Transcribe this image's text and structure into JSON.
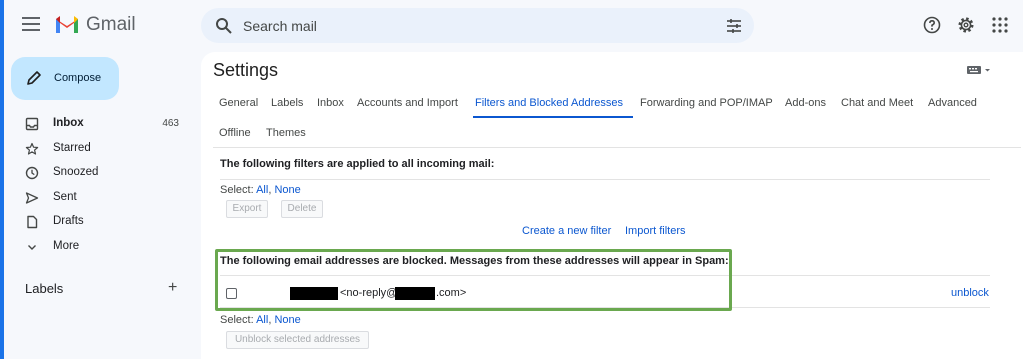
{
  "app": {
    "name": "Gmail"
  },
  "search": {
    "placeholder": "Search mail"
  },
  "sidebar": {
    "compose_label": "Compose",
    "items": [
      {
        "label": "Inbox",
        "count": "463",
        "icon": "inbox-icon",
        "bold": true
      },
      {
        "label": "Starred",
        "count": "",
        "icon": "star-icon"
      },
      {
        "label": "Snoozed",
        "count": "",
        "icon": "clock-icon"
      },
      {
        "label": "Sent",
        "count": "",
        "icon": "send-icon"
      },
      {
        "label": "Drafts",
        "count": "",
        "icon": "draft-icon"
      },
      {
        "label": "More",
        "count": "",
        "icon": "chevron-down-icon"
      }
    ],
    "labels_heading": "Labels",
    "labels_add": "+"
  },
  "settings": {
    "title": "Settings",
    "tabs": [
      "General",
      "Labels",
      "Inbox",
      "Accounts and Import",
      "Filters and Blocked Addresses",
      "Forwarding and POP/IMAP",
      "Add-ons",
      "Chat and Meet",
      "Advanced",
      "Offline",
      "Themes"
    ],
    "active_tab": "Filters and Blocked Addresses",
    "filters": {
      "heading": "The following filters are applied to all incoming mail:",
      "select_prefix": "Select:",
      "select_all": "All",
      "select_none": "None",
      "export_label": "Export",
      "delete_label": "Delete",
      "create_filter": "Create a new filter",
      "import_filters": "Import filters"
    },
    "blocked": {
      "heading": "The following email addresses are blocked. Messages from these addresses will appear in Spam:",
      "address_prefix": "<no-reply@",
      "address_suffix": ".com>",
      "unblock_label": "unblock",
      "select_prefix": "Select:",
      "select_all": "All",
      "select_none": "None",
      "unblock_selected": "Unblock selected addresses"
    }
  },
  "colors": {
    "accent": "#0b57d0",
    "compose_bg": "#c2e7ff",
    "highlight_border": "#6aa84f"
  }
}
